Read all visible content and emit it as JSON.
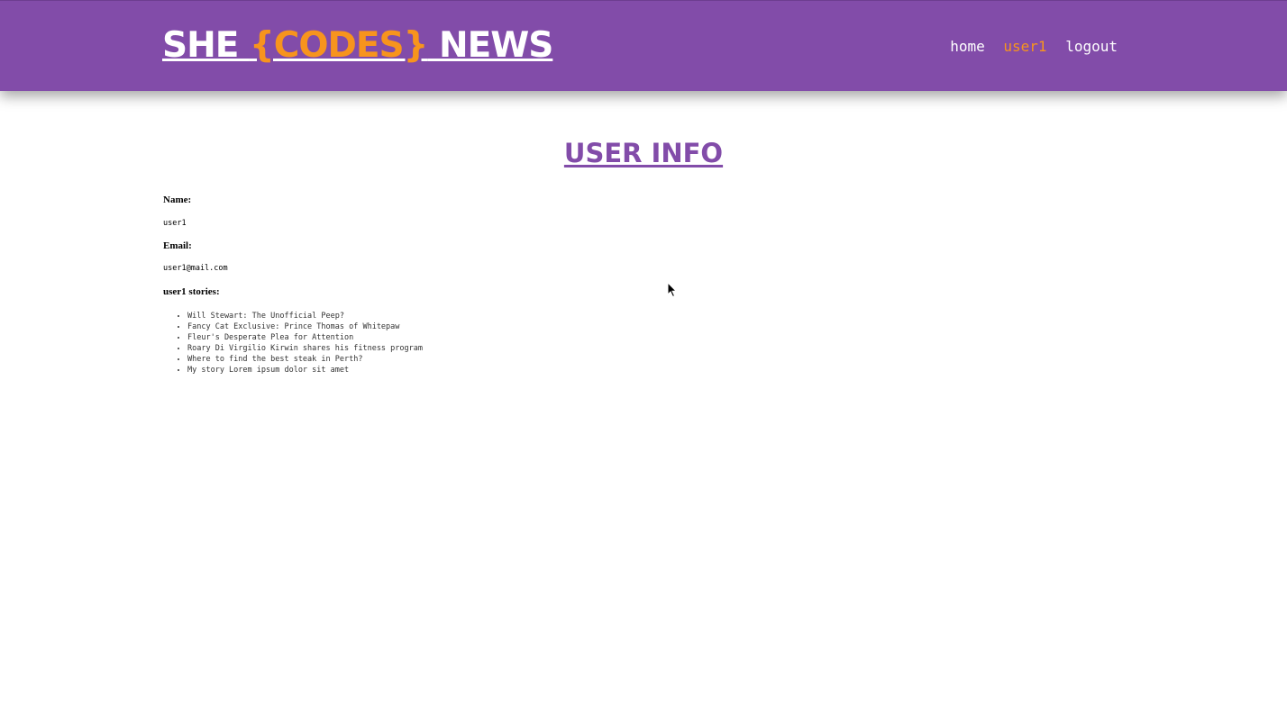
{
  "header": {
    "logo": {
      "part1": "SHE ",
      "part2": "{CODES}",
      "part3": " NEWS"
    },
    "nav": [
      {
        "label": "home"
      },
      {
        "label": "user1",
        "active": true
      },
      {
        "label": "logout"
      }
    ]
  },
  "main": {
    "title": "USER INFO",
    "name_label": "Name:",
    "name_value": "user1",
    "email_label": "Email:",
    "email_value": "user1@mail.com",
    "stories_label": "user1 stories:",
    "stories": [
      "Will Stewart: The Unofficial Peep?",
      "Fancy Cat Exclusive: Prince Thomas of Whitepaw",
      "Fleur's Desperate Plea for Attention",
      "Roary Di Virgilio Kirwin shares his fitness program",
      "Where to find the best steak in Perth?",
      "My story Lorem ipsum dolor sit amet"
    ]
  },
  "colors": {
    "header_bg": "#824ca9",
    "accent": "#f7941d",
    "title": "#824ca9"
  },
  "icons": {
    "cursor": "mouse-pointer-icon"
  }
}
